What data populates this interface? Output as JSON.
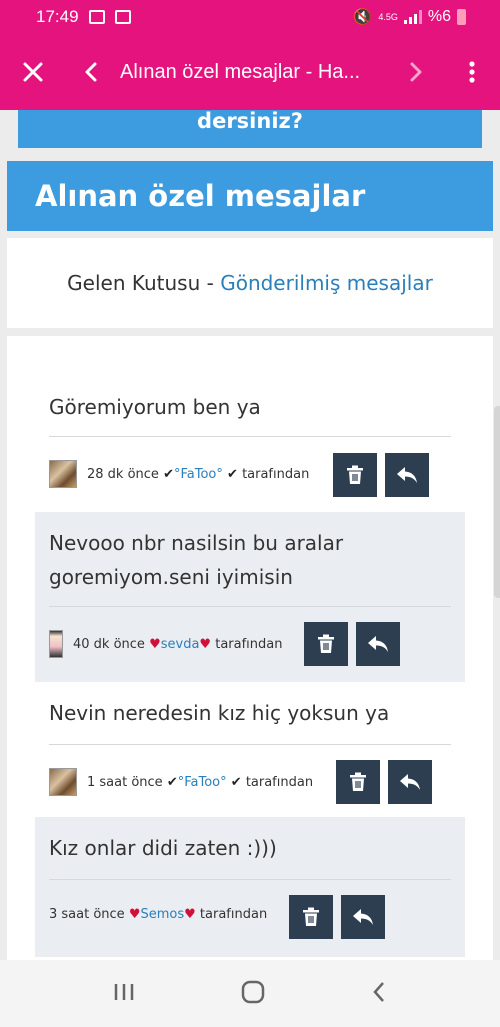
{
  "status_bar": {
    "time": "17:49",
    "network": "4.5G",
    "battery": "%6"
  },
  "toolbar": {
    "title": "Alınan özel mesajlar - Ha..."
  },
  "page": {
    "banner_text": "dersiniz?",
    "header_title": "Alınan özel mesajlar",
    "tabs": {
      "inbox": "Gelen Kutusu",
      "separator": " - ",
      "sent": "Gönderilmiş mesajlar"
    }
  },
  "messages": [
    {
      "text": "Göremiyorum ben ya",
      "time": "28 dk önce",
      "user": "°FaToo°",
      "by": "tarafından"
    },
    {
      "text": "Nevooo nbr nasilsin bu aralar goremiyom.seni iyimisin",
      "time": "40 dk önce",
      "user": "sevda",
      "by": "tarafından"
    },
    {
      "text": "Nevin neredesin kız hiç yoksun ya",
      "time": "1 saat önce",
      "user": "°FaToo°",
      "by": "tarafından"
    },
    {
      "text": "Kız onlar didi zaten :)))",
      "time": "3 saat önce",
      "user": "Semos",
      "by": "tarafından"
    }
  ],
  "colors": {
    "brand": "#e5137d",
    "header": "#3d9be0",
    "action": "#2d3e50",
    "link": "#2a7fba"
  },
  "icons": [
    "close-icon",
    "back-arrow-icon",
    "forward-arrow-icon",
    "more-vert-icon",
    "trash-icon",
    "reply-icon",
    "recents-icon",
    "home-icon",
    "back-icon"
  ]
}
